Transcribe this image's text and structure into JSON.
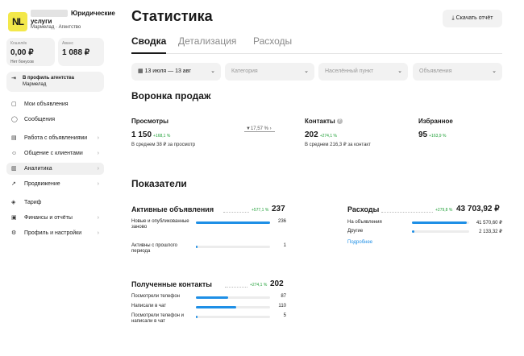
{
  "sidebar": {
    "logo": "NL",
    "org_name": "Юридические услуги",
    "org_sub": "Мармелад · Агентство",
    "wallet": {
      "label": "Кошелёк",
      "value": "0,00 ₽",
      "sub": "Нет бонусов"
    },
    "advance": {
      "label": "Аванс",
      "value": "1 088 ₽"
    },
    "agency": {
      "line1": "В профиль агентства",
      "line2": "Мармелад"
    },
    "items": [
      {
        "label": "Мои объявления",
        "icon": "listings-icon",
        "chevron": false
      },
      {
        "label": "Сообщения",
        "icon": "chat-icon",
        "chevron": false
      },
      {
        "label": "Работа с объявлениями",
        "icon": "tools-icon",
        "chevron": true
      },
      {
        "label": "Общение с клиентами",
        "icon": "clients-icon",
        "chevron": true
      },
      {
        "label": "Аналитика",
        "icon": "analytics-icon",
        "chevron": true,
        "active": true
      },
      {
        "label": "Продвижение",
        "icon": "promo-icon",
        "chevron": true
      },
      {
        "label": "Тариф",
        "icon": "tariff-icon",
        "chevron": false
      },
      {
        "label": "Финансы и отчёты",
        "icon": "finance-icon",
        "chevron": true
      },
      {
        "label": "Профиль и настройки",
        "icon": "profile-icon",
        "chevron": true
      }
    ]
  },
  "header": {
    "title": "Статистика",
    "download": "Скачать отчёт"
  },
  "tabs": [
    "Сводка",
    "Детализация",
    "Расходы"
  ],
  "filters": {
    "date": "13 июля — 13 авг",
    "category": "Категория",
    "city": "Населённый пункт",
    "ads": "Объявления"
  },
  "funnel": {
    "title": "Воронка продаж",
    "views": {
      "name": "Просмотры",
      "value": "1 150",
      "pct": "+168,1 %",
      "avg": "В среднем 38 ₽ за просмотр"
    },
    "conversion": "17,57 %",
    "contacts": {
      "name": "Контакты",
      "value": "202",
      "pct": "+274,1 %",
      "avg": "В среднем 216,3 ₽ за контакт"
    },
    "favorites": {
      "name": "Избранное",
      "value": "95",
      "pct": "+163,9 %"
    }
  },
  "indicators": {
    "title": "Показатели",
    "active": {
      "title": "Активные объявления",
      "pct": "+577,1 %",
      "value": "237",
      "rows": [
        {
          "label": "Новые и опубликованные заново",
          "value": "236",
          "fill": 0.996
        },
        {
          "label": "Активны с прошлого периода",
          "value": "1",
          "fill": 0.004
        }
      ]
    },
    "expenses": {
      "title": "Расходы",
      "pct": "+279,8 %",
      "value": "43 703,92 ₽",
      "rows": [
        {
          "label": "На объявления",
          "value": "41 570,60 ₽",
          "fill": 0.951
        },
        {
          "label": "Другие",
          "value": "2 133,32 ₽",
          "fill": 0.049
        }
      ],
      "more": "Подробнее"
    },
    "contacts": {
      "title": "Полученные контакты",
      "pct": "+274,1 %",
      "value": "202",
      "rows": [
        {
          "label": "Посмотрели телефон",
          "value": "87",
          "fill": 0.43
        },
        {
          "label": "Написали в чат",
          "value": "110",
          "fill": 0.545
        },
        {
          "label": "Посмотрели телефон и написали в чат",
          "value": "5",
          "fill": 0.025
        }
      ]
    }
  },
  "colors": {
    "accent": "#1e8fe6",
    "positive": "#21a038",
    "logo_bg": "#f3e84a"
  }
}
